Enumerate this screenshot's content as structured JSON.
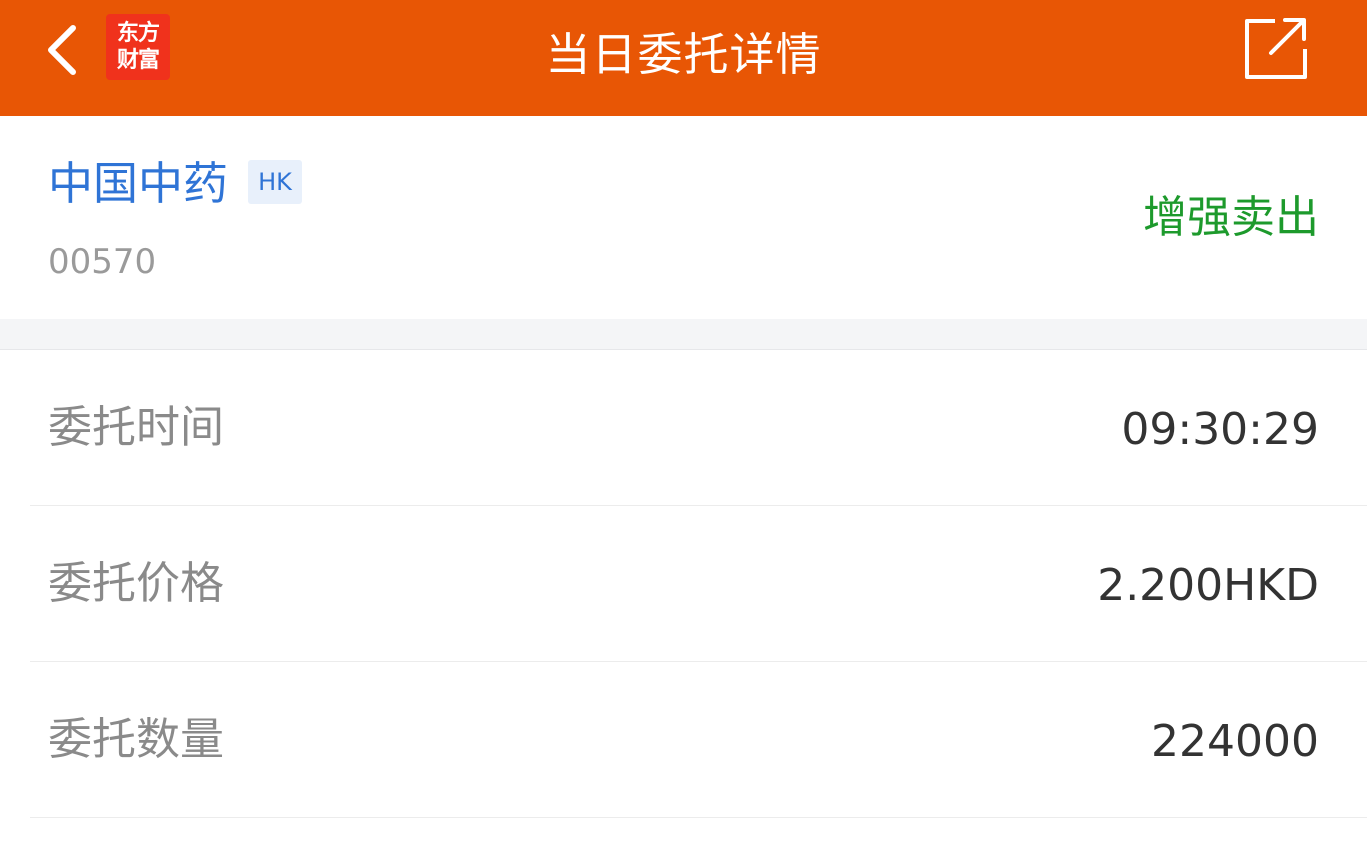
{
  "header": {
    "title": "当日委托详情",
    "logo_line1": "东方",
    "logo_line2": "财富",
    "back_icon": "chevron-left-icon",
    "share_icon": "share-out-icon",
    "color": "#e85605"
  },
  "stock": {
    "name": "中国中药",
    "market": "HK",
    "code": "00570",
    "order_type": "增强卖出",
    "name_color": "#2f74d6",
    "order_type_color": "#1d9a2c"
  },
  "details": [
    {
      "label": "委托时间",
      "value": "09:30:29"
    },
    {
      "label": "委托价格",
      "value": "2.200HKD"
    },
    {
      "label": "委托数量",
      "value": "224000"
    }
  ]
}
